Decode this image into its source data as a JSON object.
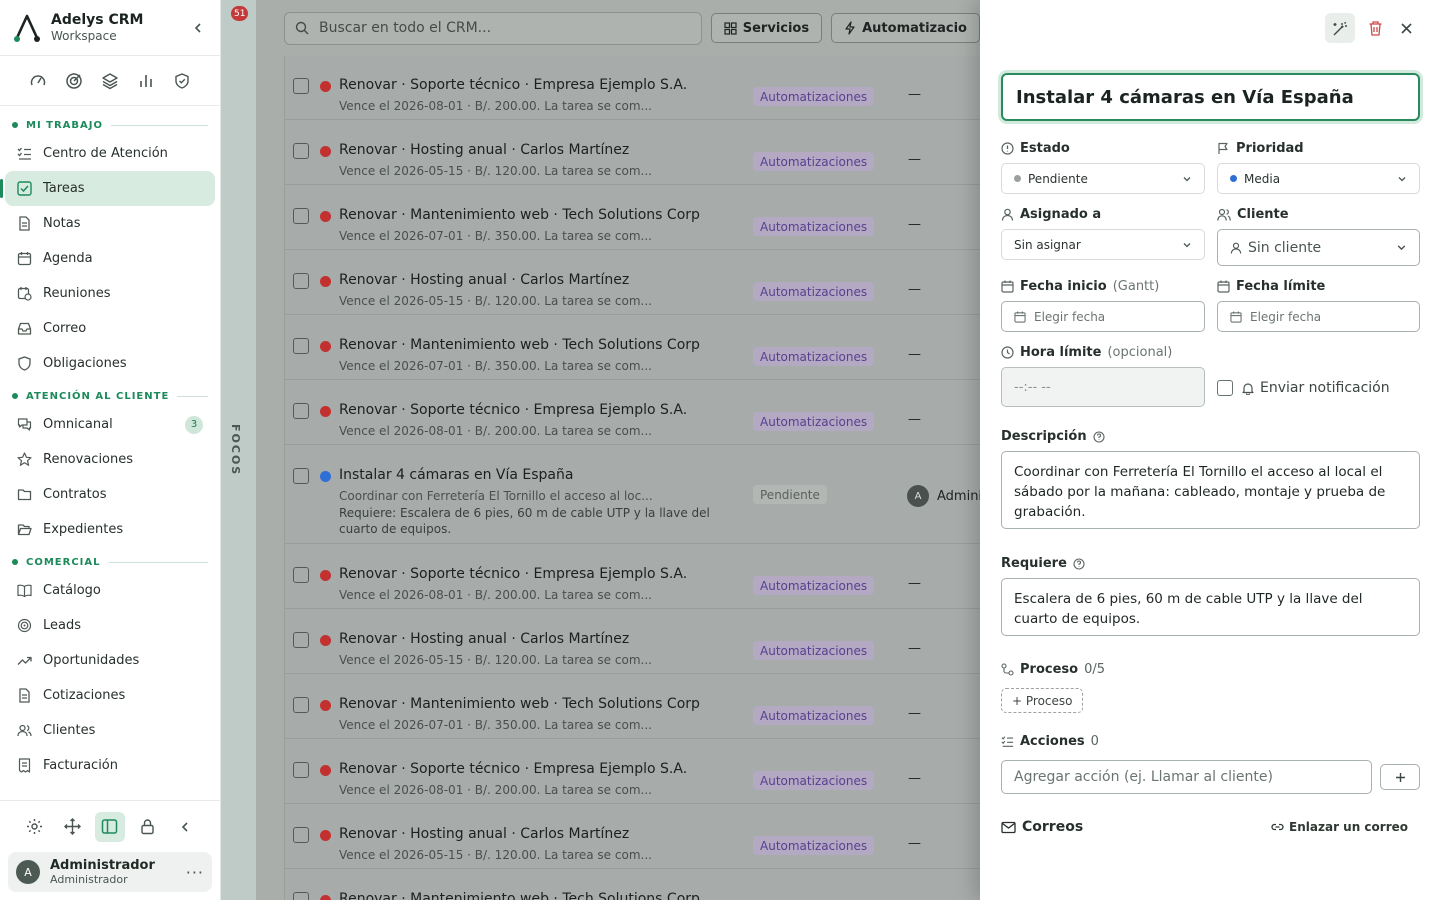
{
  "app": {
    "name": "Adelys CRM",
    "subtitle": "Workspace"
  },
  "sidebar": {
    "sections": [
      {
        "label": "MI TRABAJO",
        "items": [
          {
            "label": "Centro de Atención",
            "icon": "list-check-icon"
          },
          {
            "label": "Tareas",
            "icon": "checkbox-icon",
            "active": true
          },
          {
            "label": "Notas",
            "icon": "note-icon"
          },
          {
            "label": "Agenda",
            "icon": "calendar-icon"
          },
          {
            "label": "Reuniones",
            "icon": "calendar-clock-icon"
          },
          {
            "label": "Correo",
            "icon": "inbox-icon"
          },
          {
            "label": "Obligaciones",
            "icon": "shield-check-icon"
          }
        ]
      },
      {
        "label": "ATENCIÓN AL CLIENTE",
        "items": [
          {
            "label": "Omnicanal",
            "icon": "chat-icon",
            "badge": "3"
          },
          {
            "label": "Renovaciones",
            "icon": "star-icon"
          },
          {
            "label": "Contratos",
            "icon": "folder-icon"
          },
          {
            "label": "Expedientes",
            "icon": "folder-open-icon"
          }
        ]
      },
      {
        "label": "COMERCIAL",
        "items": [
          {
            "label": "Catálogo",
            "icon": "book-icon"
          },
          {
            "label": "Leads",
            "icon": "target-icon"
          },
          {
            "label": "Oportunidades",
            "icon": "trend-icon"
          },
          {
            "label": "Cotizaciones",
            "icon": "document-icon"
          },
          {
            "label": "Clientes",
            "icon": "users-icon"
          },
          {
            "label": "Facturación",
            "icon": "receipt-icon"
          }
        ]
      }
    ],
    "user": {
      "initial": "A",
      "name": "Administrador",
      "role": "Administrador"
    }
  },
  "focos": {
    "badge": "51",
    "label": "FOCOS"
  },
  "topbar": {
    "search_placeholder": "Buscar en todo el CRM...",
    "buttons": [
      "Servicios",
      "Automatizacio"
    ]
  },
  "tasks": [
    {
      "title": "Renovar · Soporte técnico · Empresa Ejemplo S.A.",
      "sub": "Vence el 2026-08-01 · B/. 200.00. La tarea se com...",
      "tag": "Automatizaciones",
      "owner": "—",
      "dot": "#c23030"
    },
    {
      "title": "Renovar · Hosting anual · Carlos Martínez",
      "sub": "Vence el 2026-05-15 · B/. 120.00. La tarea se com...",
      "tag": "Automatizaciones",
      "owner": "—",
      "dot": "#c23030"
    },
    {
      "title": "Renovar · Mantenimiento web · Tech Solutions Corp",
      "sub": "Vence el 2026-07-01 · B/. 350.00. La tarea se com...",
      "tag": "Automatizaciones",
      "owner": "—",
      "dot": "#c23030"
    },
    {
      "title": "Renovar · Hosting anual · Carlos Martínez",
      "sub": "Vence el 2026-05-15 · B/. 120.00. La tarea se com...",
      "tag": "Automatizaciones",
      "owner": "—",
      "dot": "#c23030"
    },
    {
      "title": "Renovar · Mantenimiento web · Tech Solutions Corp",
      "sub": "Vence el 2026-07-01 · B/. 350.00. La tarea se com...",
      "tag": "Automatizaciones",
      "owner": "—",
      "dot": "#c23030"
    },
    {
      "title": "Renovar · Soporte técnico · Empresa Ejemplo S.A.",
      "sub": "Vence el 2026-08-01 · B/. 200.00. La tarea se com...",
      "tag": "Automatizaciones",
      "owner": "—",
      "dot": "#c23030"
    },
    {
      "title": "Instalar 4 cámaras en Vía España",
      "sub": "Coordinar con Ferretería El Tornillo el acceso al loc...",
      "req": "Requiere: Escalera de 6 pies, 60 m de cable UTP y la llave del cuarto de equipos.",
      "tag": "Pendiente",
      "owner": "Adminis",
      "owner_initial": "A",
      "dot": "#2e6fd6"
    },
    {
      "title": "Renovar · Soporte técnico · Empresa Ejemplo S.A.",
      "sub": "Vence el 2026-08-01 · B/. 200.00. La tarea se com...",
      "tag": "Automatizaciones",
      "owner": "—",
      "dot": "#c23030"
    },
    {
      "title": "Renovar · Hosting anual · Carlos Martínez",
      "sub": "Vence el 2026-05-15 · B/. 120.00. La tarea se com...",
      "tag": "Automatizaciones",
      "owner": "—",
      "dot": "#c23030"
    },
    {
      "title": "Renovar · Mantenimiento web · Tech Solutions Corp",
      "sub": "Vence el 2026-07-01 · B/. 350.00. La tarea se com...",
      "tag": "Automatizaciones",
      "owner": "—",
      "dot": "#c23030"
    },
    {
      "title": "Renovar · Soporte técnico · Empresa Ejemplo S.A.",
      "sub": "Vence el 2026-08-01 · B/. 200.00. La tarea se com...",
      "tag": "Automatizaciones",
      "owner": "—",
      "dot": "#c23030"
    },
    {
      "title": "Renovar · Hosting anual · Carlos Martínez",
      "sub": "Vence el 2026-05-15 · B/. 120.00. La tarea se com...",
      "tag": "Automatizaciones",
      "owner": "—",
      "dot": "#c23030"
    },
    {
      "title": "Renovar · Mantenimiento web · Tech Solutions Corp",
      "sub": "",
      "tag": "",
      "owner": "",
      "dot": "#c23030"
    }
  ],
  "panel": {
    "title": "Instalar 4 cámaras en Vía España",
    "estado": {
      "label": "Estado",
      "value": "Pendiente",
      "dot": "#9aa09d"
    },
    "prioridad": {
      "label": "Prioridad",
      "value": "Media",
      "dot": "#2e6fd6"
    },
    "asignado": {
      "label": "Asignado a",
      "value": "Sin asignar"
    },
    "cliente": {
      "label": "Cliente",
      "value": "Sin cliente"
    },
    "fecha_inicio": {
      "label": "Fecha inicio",
      "hint": "(Gantt)",
      "placeholder": "Elegir fecha"
    },
    "fecha_limite": {
      "label": "Fecha límite",
      "placeholder": "Elegir fecha"
    },
    "hora_limite": {
      "label": "Hora límite",
      "hint": "(opcional)",
      "placeholder": "--:-- --"
    },
    "notificacion": {
      "label": "Enviar notificación"
    },
    "descripcion": {
      "label": "Descripción",
      "value": "Coordinar con Ferretería El Tornillo el acceso al local el sábado por la mañana: cableado, montaje y prueba de grabación."
    },
    "requiere": {
      "label": "Requiere",
      "value": "Escalera de 6 pies, 60 m de cable UTP y la llave del cuarto de equipos."
    },
    "proceso": {
      "label": "Proceso",
      "count": "0/5",
      "button": "+ Proceso"
    },
    "acciones": {
      "label": "Acciones",
      "count": "0",
      "placeholder": "Agregar acción (ej. Llamar al cliente)"
    },
    "correos": {
      "label": "Correos",
      "link": "Enlazar un correo"
    }
  }
}
